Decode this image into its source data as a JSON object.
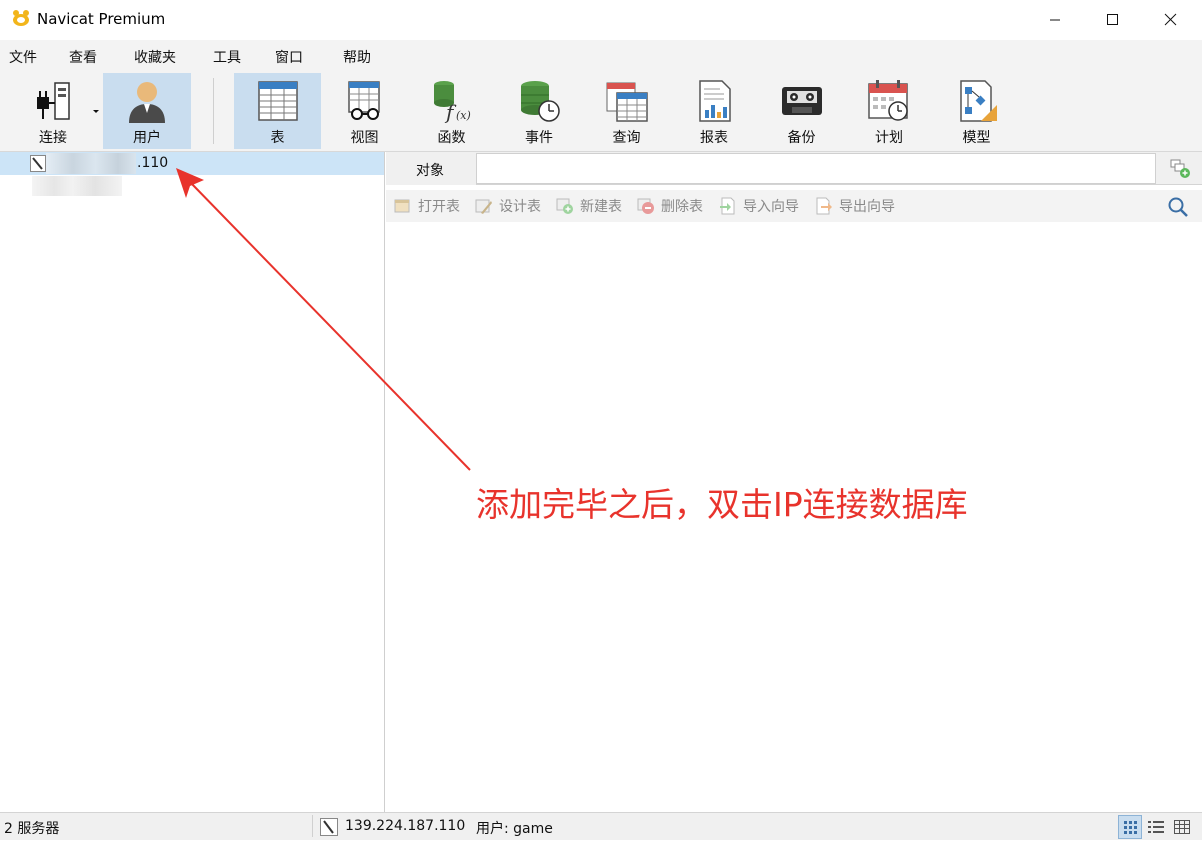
{
  "window": {
    "title": "Navicat Premium"
  },
  "menu": [
    "文件",
    "查看",
    "收藏夹",
    "工具",
    "窗口",
    "帮助"
  ],
  "toolbar": {
    "connect": "连接",
    "user": "用户",
    "table": "表",
    "view": "视图",
    "function": "函数",
    "event": "事件",
    "query": "查询",
    "report": "报表",
    "backup": "备份",
    "schedule": "计划",
    "model": "模型"
  },
  "navigator": {
    "connection_visible_text": ".110"
  },
  "object_tab": {
    "label": "对象"
  },
  "object_toolbar": {
    "open_table": "打开表",
    "design_table": "设计表",
    "new_table": "新建表",
    "delete_table": "删除表",
    "import_wizard": "导入向导",
    "export_wizard": "导出向导"
  },
  "status": {
    "server_count": "2 服务器",
    "ip": "139.224.187.110",
    "user": "用户: game"
  },
  "annotation": {
    "text": "添加完毕之后，双击IP连接数据库",
    "color": "#e8332c"
  },
  "colors": {
    "selected": "#cce4f7",
    "active_button": "#c9ddef"
  }
}
